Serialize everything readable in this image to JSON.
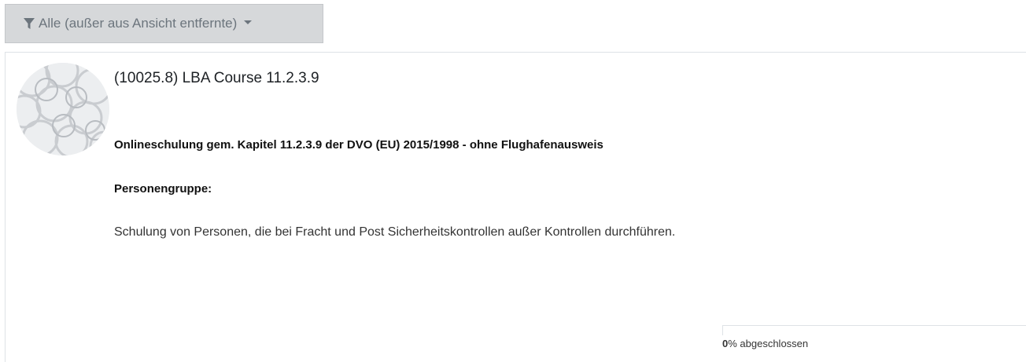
{
  "filter": {
    "label": "Alle (außer aus Ansicht entfernte)",
    "icon": "filter-icon",
    "caret_icon": "caret-down-icon"
  },
  "course": {
    "title": "(10025.8) LBA Course 11.2.3.9",
    "summary_heading": "Onlineschulung gem. Kapitel 11.2.3.9 der DVO (EU) 2015/1998 - ohne Flughafenausweis",
    "group_label": "Personengruppe:",
    "group_description": "Schulung von Personen, die bei Fracht und Post Sicherheitskontrollen außer Kontrollen durchführen.",
    "progress": {
      "percent": 0,
      "percent_text": "0",
      "suffix": "% abgeschlossen"
    }
  },
  "colors": {
    "filter_bg": "#d6d8da",
    "filter_text": "#6c757d",
    "card_border": "#dee2e6",
    "progress_fill": "#0f6cbf"
  }
}
